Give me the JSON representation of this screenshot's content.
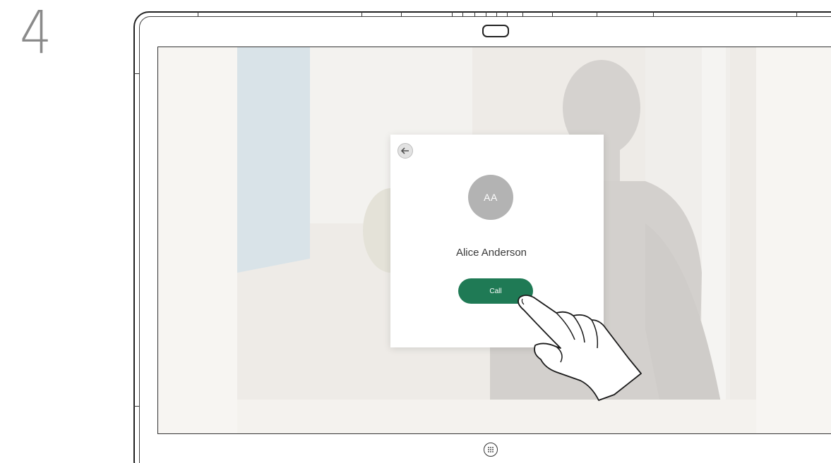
{
  "step": {
    "number": "4"
  },
  "dialog": {
    "avatar_initials": "AA",
    "contact_name": "Alice Anderson",
    "call_label": "Call"
  },
  "colors": {
    "call_button": "#1f7a55",
    "avatar": "#b3b3b3",
    "screen_background": "#f6f4f1"
  },
  "icons": {
    "back": "back-arrow-icon",
    "home": "home-grid-icon",
    "camera": "camera-icon",
    "hand": "pointing-hand-icon"
  }
}
